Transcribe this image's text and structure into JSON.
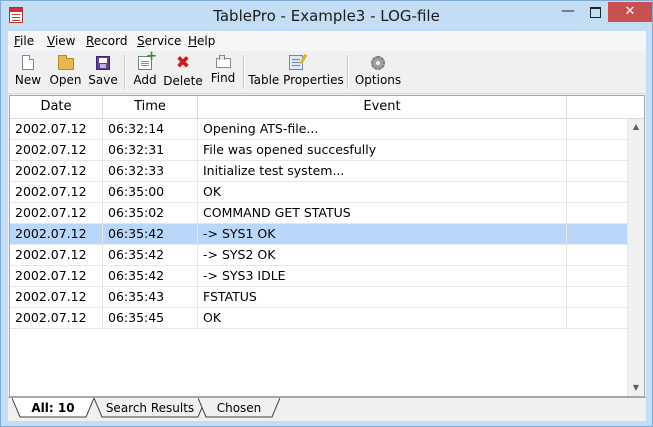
{
  "window": {
    "title": "TablePro - Example3 - LOG-file",
    "close_glyph": "✕",
    "minimize_glyph": "—"
  },
  "menu": [
    "File",
    "View",
    "Record",
    "Service",
    "Help"
  ],
  "toolbar": {
    "new": "New",
    "open": "Open",
    "save": "Save",
    "add": "Add",
    "delete": "Delete",
    "find": "Find",
    "table_properties": "Table Properties",
    "options": "Options",
    "delete_glyph": "✖"
  },
  "table": {
    "columns": [
      "Date",
      "Time",
      "Event",
      ""
    ],
    "rows": [
      {
        "date": "2002.07.12",
        "time": "06:32:14",
        "event": "Opening ATS-file..."
      },
      {
        "date": "2002.07.12",
        "time": "06:32:31",
        "event": "File was opened succesfully"
      },
      {
        "date": "2002.07.12",
        "time": "06:32:33",
        "event": "Initialize test system..."
      },
      {
        "date": "2002.07.12",
        "time": "06:35:00",
        "event": "OK"
      },
      {
        "date": "2002.07.12",
        "time": "06:35:02",
        "event": "COMMAND GET STATUS"
      },
      {
        "date": "2002.07.12",
        "time": "06:35:42",
        "event": "-> SYS1 OK"
      },
      {
        "date": "2002.07.12",
        "time": "06:35:42",
        "event": "-> SYS2 OK"
      },
      {
        "date": "2002.07.12",
        "time": "06:35:42",
        "event": "-> SYS3 IDLE"
      },
      {
        "date": "2002.07.12",
        "time": "06:35:43",
        "event": "FSTATUS"
      },
      {
        "date": "2002.07.12",
        "time": "06:35:45",
        "event": "OK"
      }
    ],
    "selected_row": 6
  },
  "tabs": [
    {
      "label": "All: 10",
      "active": true
    },
    {
      "label": "Search Results",
      "active": false
    },
    {
      "label": "Chosen",
      "active": false
    }
  ],
  "scroll": {
    "up_glyph": "▲",
    "down_glyph": "▼"
  },
  "colors": {
    "selection": "#b9d7fb",
    "title_bar": "#c3ddf5",
    "close_button": "#c75050"
  }
}
